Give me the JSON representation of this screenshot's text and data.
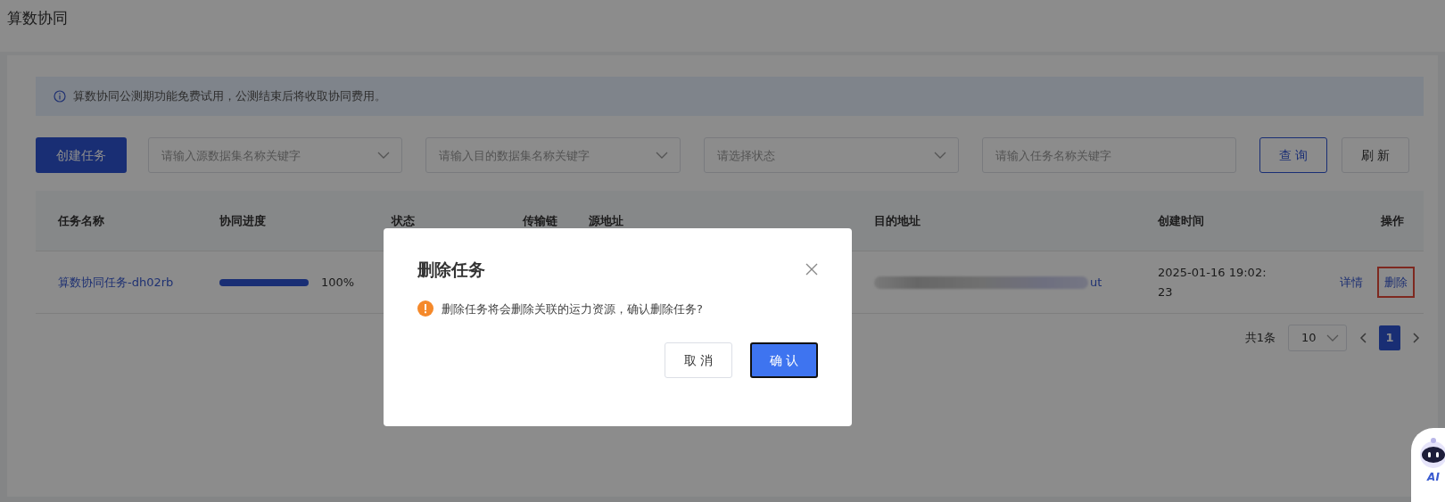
{
  "page_title": "算数协同",
  "notice": "算数协同公测期功能免费试用，公测结束后将收取协同费用。",
  "toolbar": {
    "create_button": "创建任务",
    "filters": [
      {
        "kind": "select",
        "placeholder": "请输入源数据集名称关键字"
      },
      {
        "kind": "select",
        "placeholder": "请输入目的数据集名称关键字"
      },
      {
        "kind": "select",
        "placeholder": "请选择状态"
      },
      {
        "kind": "input",
        "placeholder": "请输入任务名称关键字"
      }
    ],
    "buttons": [
      {
        "label": "查 询",
        "kind": "primary-outline"
      },
      {
        "label": "刷 新",
        "kind": "default"
      }
    ]
  },
  "table": {
    "columns": [
      "任务名称",
      "协同进度",
      "状态",
      "传输链",
      "源地址",
      "目的地址",
      "创建时间",
      "操作"
    ],
    "rows": [
      {
        "name": "算数协同任务-dh02rb",
        "progress": {
          "level": 1,
          "reading": "100%"
        },
        "destination_tail": "ut",
        "created": "2025-01-16 19:02:23",
        "actions": [
          {
            "label": "详情",
            "highlighted": false
          },
          {
            "label": "删除",
            "highlighted": true
          }
        ]
      }
    ]
  },
  "pagination": {
    "total": "共1条",
    "page_size": "10",
    "pages": [
      {
        "label": "1",
        "selected": true
      }
    ]
  },
  "dialog": {
    "title": "删除任务",
    "message": "删除任务将会删除关联的运力资源，确认删除任务?",
    "buttons": [
      {
        "label": "取 消",
        "kind": "default"
      },
      {
        "label": "确 认",
        "kind": "primary"
      }
    ]
  },
  "assistant_widget": {
    "label": "AI"
  }
}
